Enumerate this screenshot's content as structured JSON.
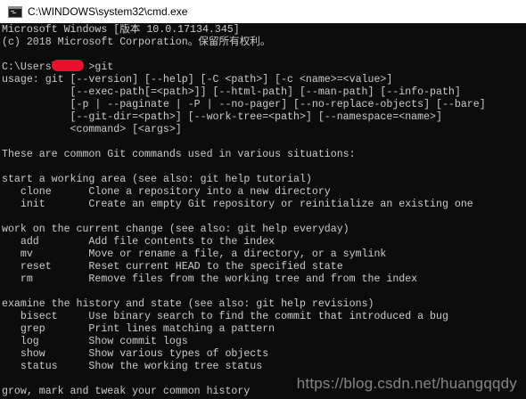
{
  "window": {
    "title": "C:\\WINDOWS\\system32\\cmd.exe",
    "icon": "cmd-icon"
  },
  "console": {
    "lines": [
      "Microsoft Windows [版本 10.0.17134.345]",
      "(c) 2018 Microsoft Corporation。保留所有权利。",
      "",
      "C:\\Users\\     >git",
      "usage: git [--version] [--help] [-C <path>] [-c <name>=<value>]",
      "           [--exec-path[=<path>]] [--html-path] [--man-path] [--info-path]",
      "           [-p | --paginate | -P | --no-pager] [--no-replace-objects] [--bare]",
      "           [--git-dir=<path>] [--work-tree=<path>] [--namespace=<name>]",
      "           <command> [<args>]",
      "",
      "These are common Git commands used in various situations:",
      "",
      "start a working area (see also: git help tutorial)",
      "   clone      Clone a repository into a new directory",
      "   init       Create an empty Git repository or reinitialize an existing one",
      "",
      "work on the current change (see also: git help everyday)",
      "   add        Add file contents to the index",
      "   mv         Move or rename a file, a directory, or a symlink",
      "   reset      Reset current HEAD to the specified state",
      "   rm         Remove files from the working tree and from the index",
      "",
      "examine the history and state (see also: git help revisions)",
      "   bisect     Use binary search to find the commit that introduced a bug",
      "   grep       Print lines matching a pattern",
      "   log        Show commit logs",
      "   show       Show various types of objects",
      "   status     Show the working tree status",
      "",
      "grow, mark and tweak your common history"
    ],
    "watermark": "https://blog.csdn.net/huangqqdy"
  }
}
